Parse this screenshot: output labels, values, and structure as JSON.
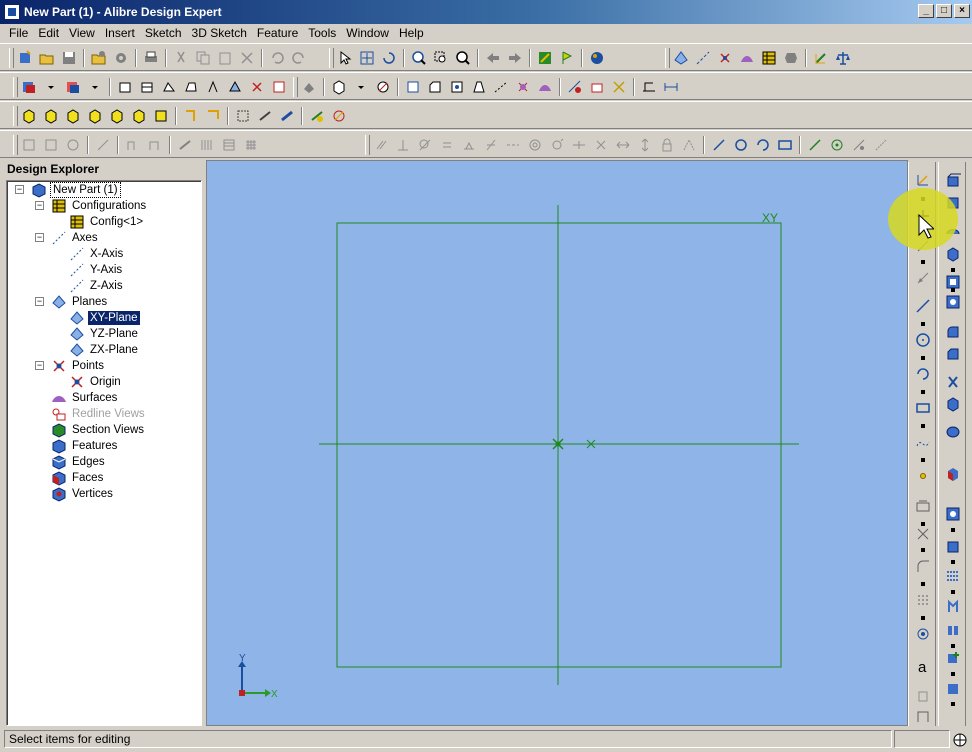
{
  "window": {
    "title": "New Part (1) - Alibre Design Expert"
  },
  "menu": [
    "File",
    "Edit",
    "View",
    "Insert",
    "Sketch",
    "3D Sketch",
    "Feature",
    "Tools",
    "Window",
    "Help"
  ],
  "explorer": {
    "title": "Design Explorer",
    "items": [
      {
        "label": "New Part (1)",
        "icon": "part-icon",
        "level": 0,
        "expander": "-"
      },
      {
        "label": "Configurations",
        "icon": "configurations-icon",
        "level": 1,
        "expander": "-"
      },
      {
        "label": "Config<1>",
        "icon": "config-icon",
        "level": 2
      },
      {
        "label": "Axes",
        "icon": "axes-icon",
        "level": 1,
        "expander": "-"
      },
      {
        "label": "X-Axis",
        "icon": "axis-icon",
        "level": 2
      },
      {
        "label": "Y-Axis",
        "icon": "axis-icon",
        "level": 2
      },
      {
        "label": "Z-Axis",
        "icon": "axis-icon",
        "level": 2
      },
      {
        "label": "Planes",
        "icon": "planes-icon",
        "level": 1,
        "expander": "-"
      },
      {
        "label": "XY-Plane",
        "icon": "plane-icon",
        "level": 2,
        "selected": true
      },
      {
        "label": "YZ-Plane",
        "icon": "plane-icon",
        "level": 2
      },
      {
        "label": "ZX-Plane",
        "icon": "plane-icon",
        "level": 2
      },
      {
        "label": "Points",
        "icon": "points-icon",
        "level": 1,
        "expander": "-"
      },
      {
        "label": "Origin",
        "icon": "origin-icon",
        "level": 2
      },
      {
        "label": "Surfaces",
        "icon": "surfaces-icon",
        "level": 1
      },
      {
        "label": "Redline Views",
        "icon": "redline-views-icon",
        "level": 1,
        "dim": true
      },
      {
        "label": "Section Views",
        "icon": "section-views-icon",
        "level": 1
      },
      {
        "label": "Features",
        "icon": "features-icon",
        "level": 1
      },
      {
        "label": "Edges",
        "icon": "edges-icon",
        "level": 1
      },
      {
        "label": "Faces",
        "icon": "faces-icon",
        "level": 1
      },
      {
        "label": "Vertices",
        "icon": "vertices-icon",
        "level": 1
      }
    ]
  },
  "canvas": {
    "plane_label": "XY",
    "axis_y_label": "Y",
    "axis_x_label": "X",
    "background": "#8eb4e8",
    "sketch_color": "#1e8a1e"
  },
  "status": {
    "text": "Select items for editing"
  }
}
